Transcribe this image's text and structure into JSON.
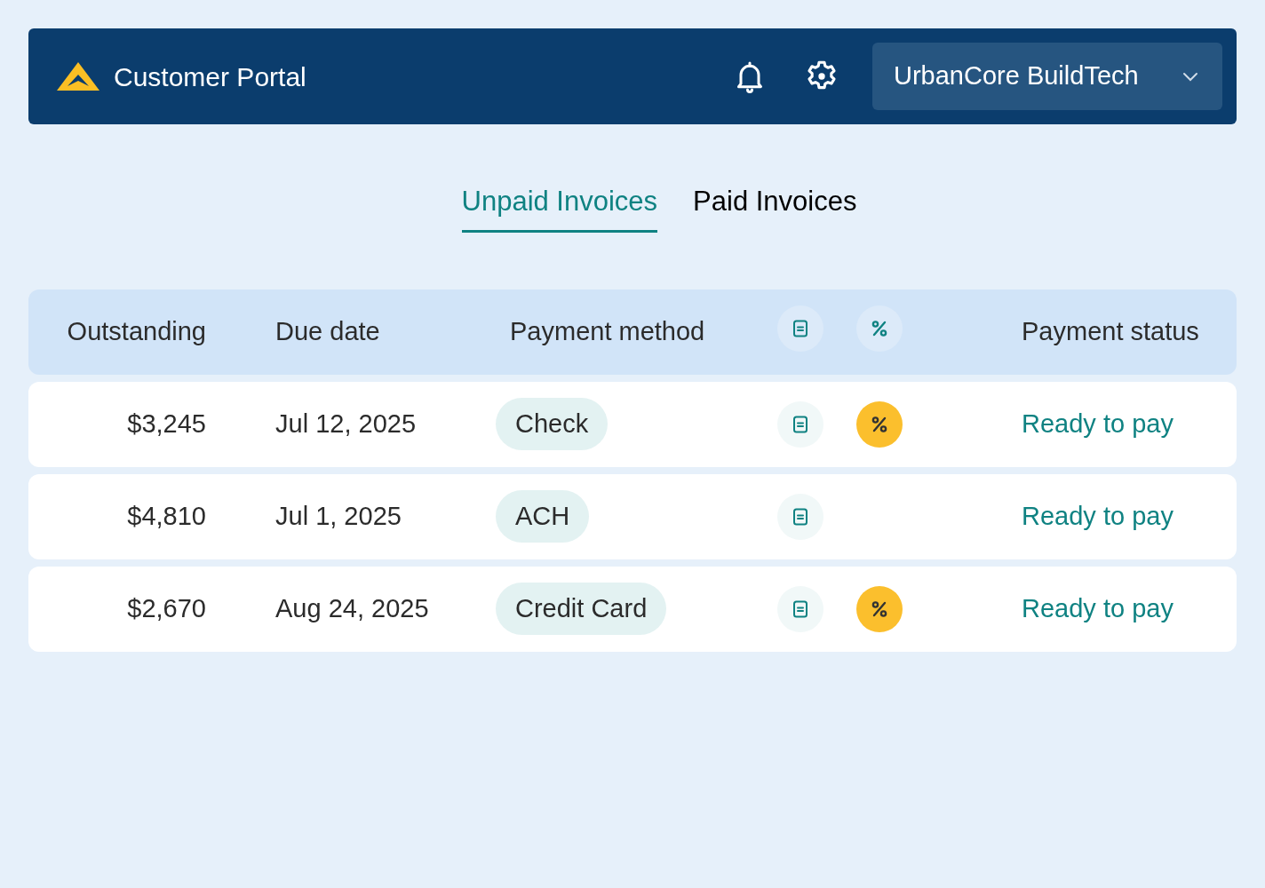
{
  "header": {
    "title": "Customer Portal",
    "account": "UrbanCore BuildTech"
  },
  "tabs": [
    {
      "label": "Unpaid Invoices",
      "selected": true
    },
    {
      "label": "Paid Invoices",
      "selected": false
    }
  ],
  "table": {
    "columns": [
      "Outstanding",
      "Due date",
      "Payment method",
      "Payment status"
    ],
    "rows": [
      {
        "outstanding": "$3,245",
        "due_date": "Jul 12, 2025",
        "payment_method": "Check",
        "discount": true,
        "status": "Ready to pay"
      },
      {
        "outstanding": "$4,810",
        "due_date": "Jul 1, 2025",
        "payment_method": "ACH",
        "discount": false,
        "status": "Ready to pay"
      },
      {
        "outstanding": "$2,670",
        "due_date": "Aug 24, 2025",
        "payment_method": "Credit Card",
        "discount": true,
        "status": "Ready to pay"
      }
    ]
  }
}
